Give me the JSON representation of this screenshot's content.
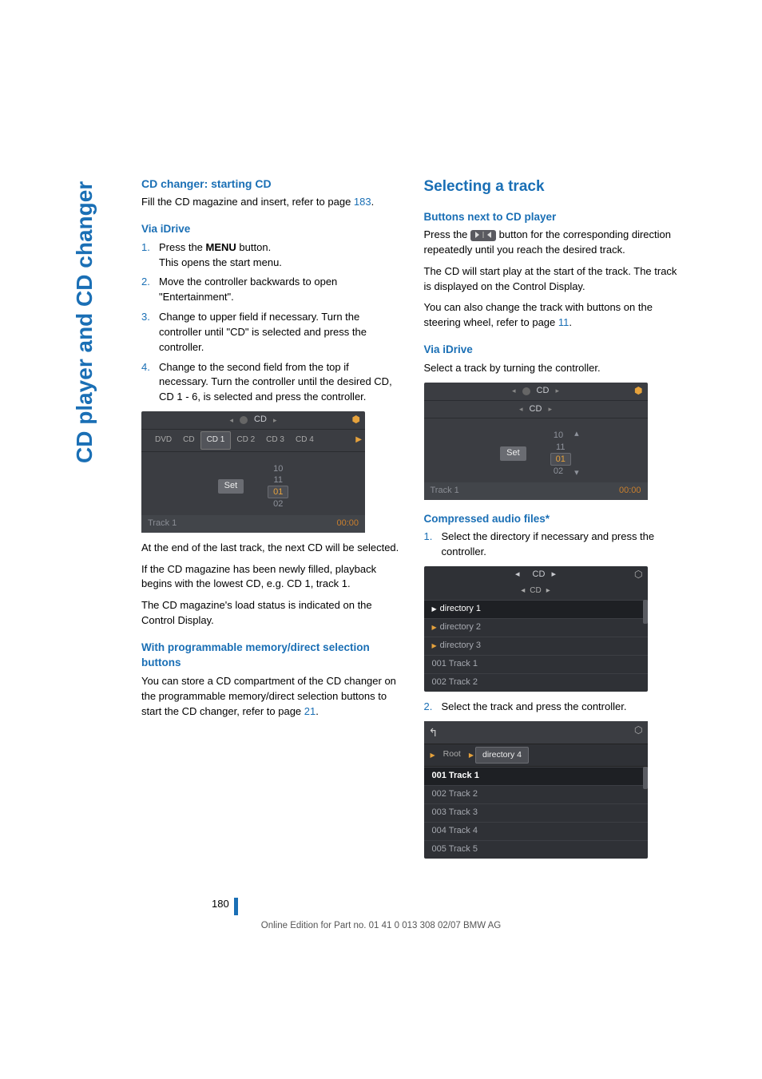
{
  "sidebar_title": "CD player and CD changer",
  "left": {
    "h1": "CD changer: starting CD",
    "p1_a": "Fill the CD magazine and insert, refer to page ",
    "p1_link": "183",
    "p1_b": ".",
    "h2": "Via iDrive",
    "ol1": {
      "i1a": "Press the ",
      "i1b": "MENU",
      "i1c": " button.",
      "i1d": "This opens the start menu.",
      "i2": "Move the controller backwards to open \"Entertainment\".",
      "i3": "Change to upper field if necessary. Turn the controller until \"CD\" is selected and press the controller.",
      "i4": "Change to the second field from the top if necessary. Turn the controller until the desired CD, CD 1 - 6, is selected and press the controller."
    },
    "shot1": {
      "top_label": "CD",
      "tabs": [
        "DVD",
        "CD",
        "CD 1",
        "CD 2",
        "CD 3",
        "CD 4"
      ],
      "active_tab": 2,
      "set": "Set",
      "nums": [
        "10",
        "11",
        "01",
        "02"
      ],
      "hl_index": 2,
      "track": "Track 1",
      "time": "00:00"
    },
    "p2": "At the end of the last track, the next CD will be selected.",
    "p3": "If the CD magazine has been newly filled, playback begins with the lowest CD, e.g. CD 1, track 1.",
    "p4": "The CD magazine's load status is indicated on the Control Display.",
    "h3": "With programmable memory/direct selection buttons",
    "p5_a": "You can store a CD compartment of the CD changer on the programmable memory/direct selection buttons to start the CD changer, refer to page ",
    "p5_link": "21",
    "p5_b": "."
  },
  "right": {
    "h1": "Selecting a track",
    "h2": "Buttons next to CD player",
    "p1_a": "Press the ",
    "p1_b": " button for the corresponding direction repeatedly until you reach the desired track.",
    "p2": "The CD will start play at the start of the track. The track is displayed on the Control Display.",
    "p3_a": "You can also change the track with buttons on the steering wheel, refer to page ",
    "p3_link": "11",
    "p3_b": ".",
    "h3": "Via iDrive",
    "p4": "Select a track by turning the controller.",
    "shot2": {
      "top_label": "CD",
      "sub_label": "CD",
      "set": "Set",
      "nums": [
        "10",
        "11",
        "01",
        "02"
      ],
      "hl_index": 2,
      "track": "Track 1",
      "time": "00:00"
    },
    "h4": "Compressed audio files*",
    "ol1_i1": "Select the directory if necessary and press the controller.",
    "shot3": {
      "top_label": "CD",
      "sub_label": "CD",
      "rows": [
        "directory 1",
        "directory 2",
        "directory 3",
        "001 Track 1",
        "002 Track 2"
      ],
      "active": 0
    },
    "ol1_i2": "Select the track and press the controller.",
    "shot4": {
      "crumb": [
        "Root",
        "directory 4"
      ],
      "crumb_active": 1,
      "rows": [
        "001 Track 1",
        "002 Track 2",
        "003 Track 3",
        "004 Track 4",
        "005 Track 5"
      ],
      "active": 0
    }
  },
  "page_number": "180",
  "footer": "Online Edition for Part no. 01 41 0 013 308 02/07 BMW AG"
}
